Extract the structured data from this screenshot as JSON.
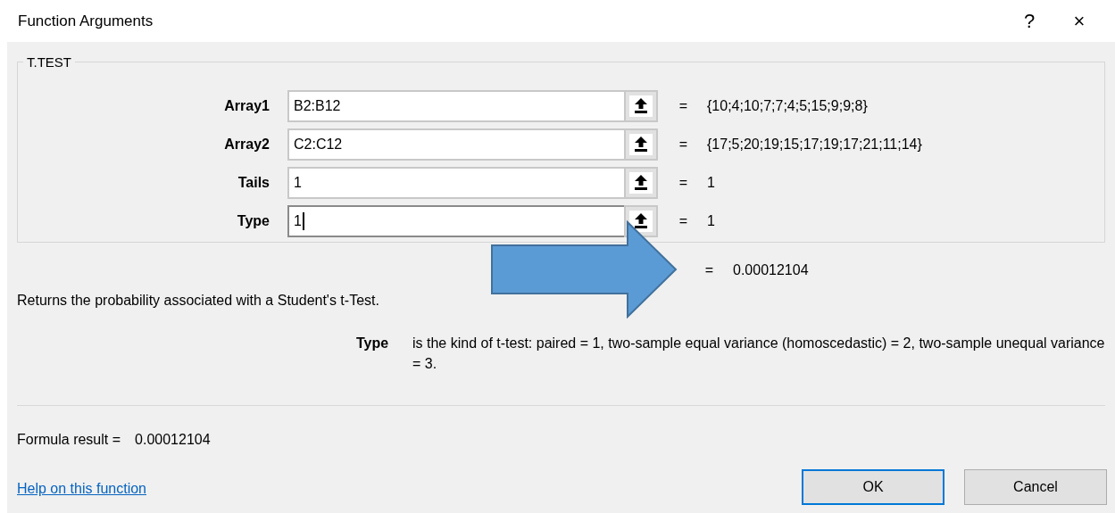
{
  "window": {
    "title": "Function Arguments",
    "help_button": "?",
    "close_button": "×"
  },
  "group": {
    "title": "T.TEST",
    "arguments": [
      {
        "label": "Array1",
        "value": "B2:B12",
        "equals": "=",
        "result": "{10;4;10;7;7;4;5;15;9;9;8}",
        "focused": false
      },
      {
        "label": "Array2",
        "value": "C2:C12",
        "equals": "=",
        "result": "{17;5;20;19;15;17;19;17;21;11;14}",
        "focused": false
      },
      {
        "label": "Tails",
        "value": "1",
        "equals": "=",
        "result": "1",
        "focused": false
      },
      {
        "label": "Type",
        "value": "1",
        "equals": "=",
        "result": "1",
        "focused": true
      }
    ]
  },
  "function_result": {
    "equals": "=",
    "value": "0.00012104"
  },
  "description": "Returns the probability associated with a Student's t-Test.",
  "argument_help": {
    "name": "Type",
    "text": "is the kind of t-test: paired = 1, two-sample equal variance (homoscedastic) = 2, two-sample unequal variance = 3."
  },
  "formula_result": {
    "label": "Formula result =",
    "value": "0.00012104"
  },
  "help_link": "Help on this function",
  "buttons": [
    {
      "label": "OK",
      "default": true
    },
    {
      "label": "Cancel",
      "default": false
    }
  ],
  "annotation": {
    "kind": "arrow",
    "color": "#5b9bd5"
  }
}
